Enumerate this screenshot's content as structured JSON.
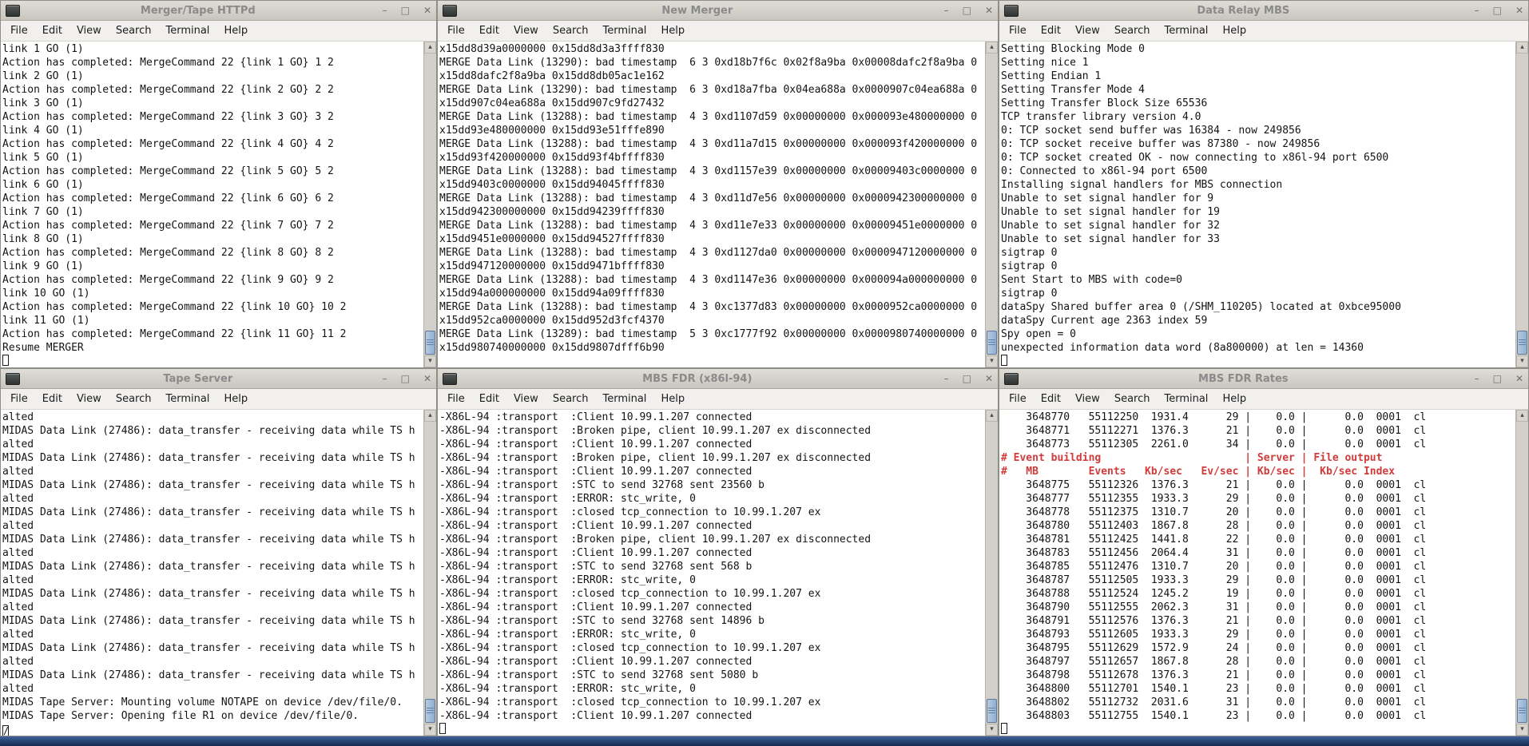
{
  "menu": [
    "File",
    "Edit",
    "View",
    "Search",
    "Terminal",
    "Help"
  ],
  "icons": {
    "minimize": "–",
    "maximize": "□",
    "close": "✕",
    "scroll_up": "▴",
    "scroll_down": "▾"
  },
  "colors": {
    "rates_header_red": "#d03b3b",
    "scroll_thumb_blue": "#8fafd0",
    "taskbar_blue": "#2a4679",
    "titlebar_gray": "#d3d0ca"
  },
  "windows": [
    {
      "title": "Merger/Tape HTTPd",
      "cursor": "",
      "lines": [
        "link 1 GO (1)",
        "Action has completed: MergeCommand 22 {link 1 GO} 1 2",
        "link 2 GO (1)",
        "Action has completed: MergeCommand 22 {link 2 GO} 2 2",
        "link 3 GO (1)",
        "Action has completed: MergeCommand 22 {link 3 GO} 3 2",
        "link 4 GO (1)",
        "Action has completed: MergeCommand 22 {link 4 GO} 4 2",
        "link 5 GO (1)",
        "Action has completed: MergeCommand 22 {link 5 GO} 5 2",
        "link 6 GO (1)",
        "Action has completed: MergeCommand 22 {link 6 GO} 6 2",
        "link 7 GO (1)",
        "Action has completed: MergeCommand 22 {link 7 GO} 7 2",
        "link 8 GO (1)",
        "Action has completed: MergeCommand 22 {link 8 GO} 8 2",
        "link 9 GO (1)",
        "Action has completed: MergeCommand 22 {link 9 GO} 9 2",
        "link 10 GO (1)",
        "Action has completed: MergeCommand 22 {link 10 GO} 10 2",
        "link 11 GO (1)",
        "Action has completed: MergeCommand 22 {link 11 GO} 11 2",
        "Resume MERGER"
      ]
    },
    {
      "title": "New Merger",
      "cursor": null,
      "lines": [
        "x15dd8d39a0000000 0x15dd8d3a3ffff830",
        "MERGE Data Link (13290): bad timestamp  6 3 0xd18b7f6c 0x02f8a9ba 0x00008dafc2f8a9ba 0",
        "x15dd8dafc2f8a9ba 0x15dd8db05ac1e162",
        "MERGE Data Link (13290): bad timestamp  6 3 0xd18a7fba 0x04ea688a 0x0000907c04ea688a 0",
        "x15dd907c04ea688a 0x15dd907c9fd27432",
        "MERGE Data Link (13288): bad timestamp  4 3 0xd1107d59 0x00000000 0x000093e480000000 0",
        "x15dd93e480000000 0x15dd93e51fffe890",
        "MERGE Data Link (13288): bad timestamp  4 3 0xd11a7d15 0x00000000 0x000093f420000000 0",
        "x15dd93f420000000 0x15dd93f4bffff830",
        "MERGE Data Link (13288): bad timestamp  4 3 0xd1157e39 0x00000000 0x00009403c0000000 0",
        "x15dd9403c0000000 0x15dd94045ffff830",
        "MERGE Data Link (13288): bad timestamp  4 3 0xd11d7e56 0x00000000 0x0000942300000000 0",
        "x15dd942300000000 0x15dd94239ffff830",
        "MERGE Data Link (13288): bad timestamp  4 3 0xd11e7e33 0x00000000 0x00009451e0000000 0",
        "x15dd9451e0000000 0x15dd94527ffff830",
        "MERGE Data Link (13288): bad timestamp  4 3 0xd1127da0 0x00000000 0x0000947120000000 0",
        "x15dd947120000000 0x15dd9471bffff830",
        "MERGE Data Link (13288): bad timestamp  4 3 0xd1147e36 0x00000000 0x000094a000000000 0",
        "x15dd94a000000000 0x15dd94a09ffff830",
        "MERGE Data Link (13288): bad timestamp  4 3 0xc1377d83 0x00000000 0x0000952ca0000000 0",
        "x15dd952ca0000000 0x15dd952d3fcf4370",
        "MERGE Data Link (13289): bad timestamp  5 3 0xc1777f92 0x00000000 0x0000980740000000 0",
        "x15dd980740000000 0x15dd9807dfff6b90"
      ]
    },
    {
      "title": "Data Relay MBS",
      "cursor": "",
      "lines": [
        "Setting Blocking Mode 0",
        "Setting nice 1",
        "Setting Endian 1",
        "Setting Transfer Mode 4",
        "Setting Transfer Block Size 65536",
        "TCP transfer library version 4.0",
        "0: TCP socket send buffer was 16384 - now 249856",
        "0: TCP socket receive buffer was 87380 - now 249856",
        "0: TCP socket created OK - now connecting to x86l-94 port 6500",
        "0: Connected to x86l-94 port 6500",
        "Installing signal handlers for MBS connection",
        "Unable to set signal handler for 9",
        "Unable to set signal handler for 19",
        "Unable to set signal handler for 32",
        "Unable to set signal handler for 33",
        "sigtrap 0",
        "sigtrap 0",
        "Sent Start to MBS with code=0",
        "sigtrap 0",
        "dataSpy Shared buffer area 0 (/SHM_110205) located at 0xbce95000",
        "dataSpy Current age 2363 index 59",
        "Spy open = 0",
        "unexpected information data word (8a800000) at len = 14360"
      ]
    },
    {
      "title": "Tape Server",
      "cursor": "/",
      "lines": [
        "alted",
        "MIDAS Data Link (27486): data_transfer - receiving data while TS h",
        "alted",
        "MIDAS Data Link (27486): data_transfer - receiving data while TS h",
        "alted",
        "MIDAS Data Link (27486): data_transfer - receiving data while TS h",
        "alted",
        "MIDAS Data Link (27486): data_transfer - receiving data while TS h",
        "alted",
        "MIDAS Data Link (27486): data_transfer - receiving data while TS h",
        "alted",
        "MIDAS Data Link (27486): data_transfer - receiving data while TS h",
        "alted",
        "MIDAS Data Link (27486): data_transfer - receiving data while TS h",
        "alted",
        "MIDAS Data Link (27486): data_transfer - receiving data while TS h",
        "alted",
        "MIDAS Data Link (27486): data_transfer - receiving data while TS h",
        "alted",
        "MIDAS Data Link (27486): data_transfer - receiving data while TS h",
        "alted",
        "MIDAS Tape Server: Mounting volume NOTAPE on device /dev/file/0.",
        "MIDAS Tape Server: Opening file R1 on device /dev/file/0."
      ]
    },
    {
      "title": "MBS FDR (x86l-94)",
      "cursor": "",
      "lines": [
        "-X86L-94 :transport  :Client 10.99.1.207 connected",
        "-X86L-94 :transport  :Broken pipe, client 10.99.1.207 ex disconnected",
        "-X86L-94 :transport  :Client 10.99.1.207 connected",
        "-X86L-94 :transport  :Broken pipe, client 10.99.1.207 ex disconnected",
        "-X86L-94 :transport  :Client 10.99.1.207 connected",
        "-X86L-94 :transport  :STC to send 32768 sent 23560 b",
        "-X86L-94 :transport  :ERROR: stc_write, 0",
        "-X86L-94 :transport  :closed tcp_connection to 10.99.1.207 ex",
        "-X86L-94 :transport  :Client 10.99.1.207 connected",
        "-X86L-94 :transport  :Broken pipe, client 10.99.1.207 ex disconnected",
        "-X86L-94 :transport  :Client 10.99.1.207 connected",
        "-X86L-94 :transport  :STC to send 32768 sent 568 b",
        "-X86L-94 :transport  :ERROR: stc_write, 0",
        "-X86L-94 :transport  :closed tcp_connection to 10.99.1.207 ex",
        "-X86L-94 :transport  :Client 10.99.1.207 connected",
        "-X86L-94 :transport  :STC to send 32768 sent 14896 b",
        "-X86L-94 :transport  :ERROR: stc_write, 0",
        "-X86L-94 :transport  :closed tcp_connection to 10.99.1.207 ex",
        "-X86L-94 :transport  :Client 10.99.1.207 connected",
        "-X86L-94 :transport  :STC to send 32768 sent 5080 b",
        "-X86L-94 :transport  :ERROR: stc_write, 0",
        "-X86L-94 :transport  :closed tcp_connection to 10.99.1.207 ex",
        "-X86L-94 :transport  :Client 10.99.1.207 connected"
      ]
    },
    {
      "title": "MBS FDR Rates",
      "cursor": "",
      "lines": [
        "    3648770   55112250  1931.4      29 |    0.0 |      0.0  0001  cl",
        "    3648771   55112271  1376.3      21 |    0.0 |      0.0  0001  cl",
        "    3648773   55112305  2261.0      34 |    0.0 |      0.0  0001  cl",
        {
          "text": "# Event building                       | Server | File output",
          "red": true
        },
        {
          "text": "#   MB        Events   Kb/sec   Ev/sec | Kb/sec |  Kb/sec Index",
          "red": true
        },
        "    3648775   55112326  1376.3      21 |    0.0 |      0.0  0001  cl",
        "    3648777   55112355  1933.3      29 |    0.0 |      0.0  0001  cl",
        "    3648778   55112375  1310.7      20 |    0.0 |      0.0  0001  cl",
        "    3648780   55112403  1867.8      28 |    0.0 |      0.0  0001  cl",
        "    3648781   55112425  1441.8      22 |    0.0 |      0.0  0001  cl",
        "    3648783   55112456  2064.4      31 |    0.0 |      0.0  0001  cl",
        "    3648785   55112476  1310.7      20 |    0.0 |      0.0  0001  cl",
        "    3648787   55112505  1933.3      29 |    0.0 |      0.0  0001  cl",
        "    3648788   55112524  1245.2      19 |    0.0 |      0.0  0001  cl",
        "    3648790   55112555  2062.3      31 |    0.0 |      0.0  0001  cl",
        "    3648791   55112576  1376.3      21 |    0.0 |      0.0  0001  cl",
        "    3648793   55112605  1933.3      29 |    0.0 |      0.0  0001  cl",
        "    3648795   55112629  1572.9      24 |    0.0 |      0.0  0001  cl",
        "    3648797   55112657  1867.8      28 |    0.0 |      0.0  0001  cl",
        "    3648798   55112678  1376.3      21 |    0.0 |      0.0  0001  cl",
        "    3648800   55112701  1540.1      23 |    0.0 |      0.0  0001  cl",
        "    3648802   55112732  2031.6      31 |    0.0 |      0.0  0001  cl",
        "    3648803   55112755  1540.1      23 |    0.0 |      0.0  0001  cl"
      ]
    }
  ]
}
